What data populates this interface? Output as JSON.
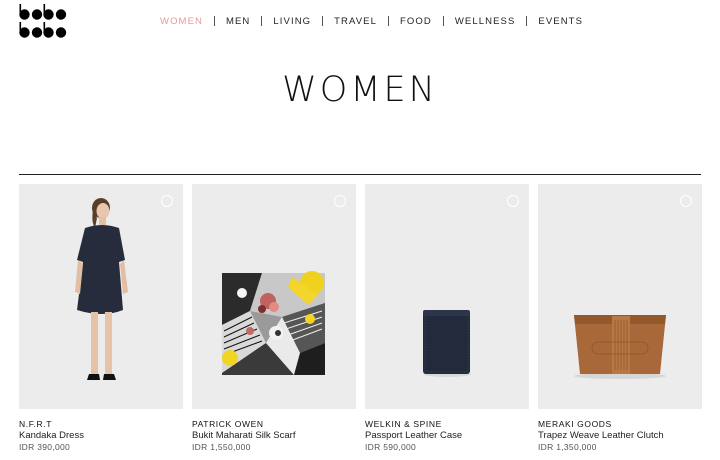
{
  "logo_text": "bobo",
  "nav": [
    {
      "label": "WOMEN",
      "active": true
    },
    {
      "label": "MEN"
    },
    {
      "label": "LIVING"
    },
    {
      "label": "TRAVEL"
    },
    {
      "label": "FOOD"
    },
    {
      "label": "WELLNESS"
    },
    {
      "label": "EVENTS"
    }
  ],
  "page_title": "WOMEN",
  "accent_color": "#e89a9a",
  "products": [
    {
      "brand": "N.F.R.T",
      "name": "Kandaka Dress",
      "price": "IDR 390,000",
      "image": "model-in-navy-dress"
    },
    {
      "brand": "PATRICK OWEN",
      "name": "Bukit Maharati Silk Scarf",
      "price": "IDR 1,550,000",
      "image": "patterned-silk-scarf"
    },
    {
      "brand": "WELKIN & SPINE",
      "name": "Passport Leather Case",
      "price": "IDR 590,000",
      "image": "navy-passport-case"
    },
    {
      "brand": "MERAKI GOODS",
      "name": "Trapez Weave Leather Clutch",
      "price": "IDR 1,350,000",
      "image": "tan-leather-clutch"
    }
  ]
}
